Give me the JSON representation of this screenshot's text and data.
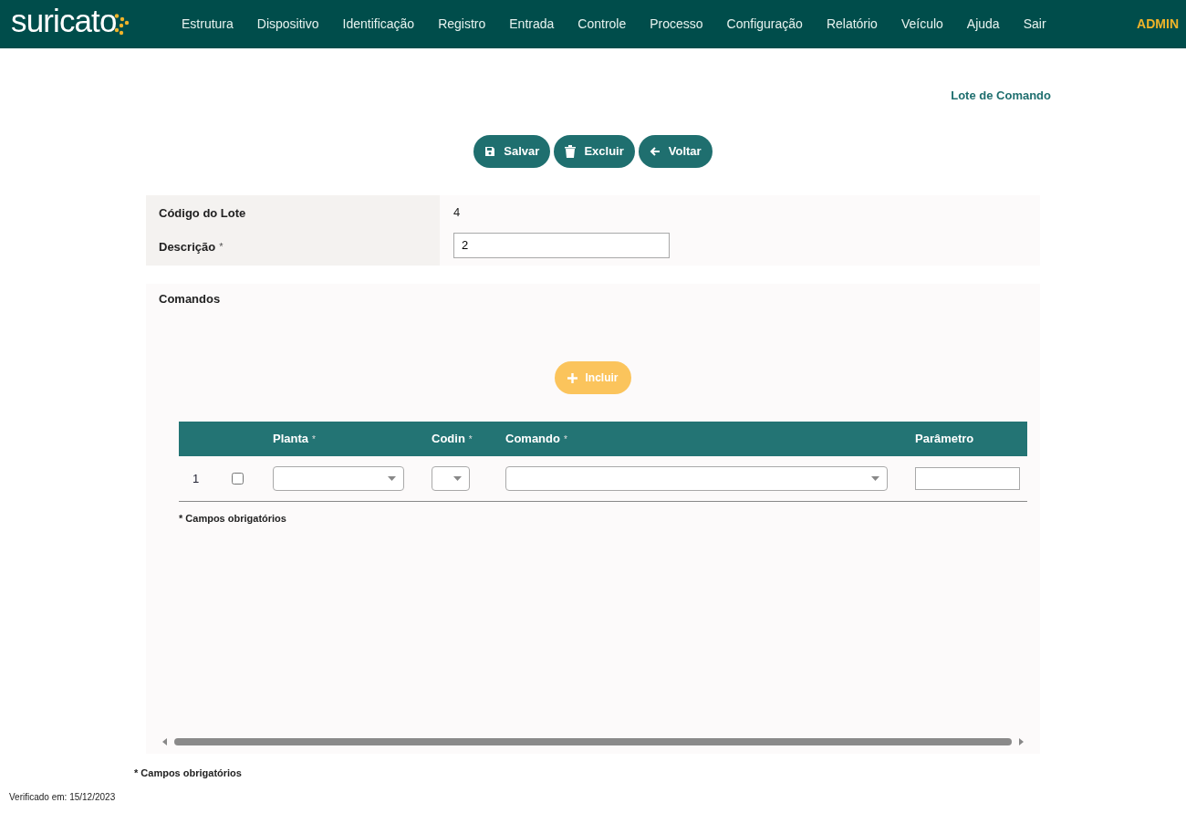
{
  "header": {
    "logo": "suricato",
    "menu": [
      {
        "label": "Estrutura"
      },
      {
        "label": "Dispositivo"
      },
      {
        "label": "Identificação"
      },
      {
        "label": "Registro"
      },
      {
        "label": "Entrada"
      },
      {
        "label": "Controle"
      },
      {
        "label": "Processo"
      },
      {
        "label": "Configuração"
      },
      {
        "label": "Relatório"
      },
      {
        "label": "Veículo"
      },
      {
        "label": "Ajuda"
      },
      {
        "label": "Sair"
      }
    ],
    "user": "ADMIN"
  },
  "page_title": "Lote de Comando",
  "actions": [
    {
      "kind": "save",
      "label": "Salvar"
    },
    {
      "kind": "delete",
      "label": "Excluir"
    },
    {
      "kind": "back",
      "label": "Voltar"
    }
  ],
  "form": [
    {
      "label": "Código do Lote",
      "kind": "text",
      "value": "4"
    },
    {
      "label": "Descrição",
      "required_mark": "*",
      "kind": "input",
      "value": "2"
    }
  ],
  "commands": {
    "title": "Comandos",
    "add_button": {
      "label": "Incluir",
      "disabled": true
    },
    "columns": [
      {
        "label": "Planta",
        "required_mark": "*"
      },
      {
        "label": "Codin",
        "required_mark": "*"
      },
      {
        "label": "Comando",
        "required_mark": "*"
      },
      {
        "label": "Parâmetro"
      }
    ],
    "rows": [
      {
        "number": "1",
        "checked": false
      }
    ],
    "note": "* Campos obrigatórios"
  },
  "footer_note": "* Campos obrigatórios",
  "verified": "Verificado em: 15/12/2023"
}
